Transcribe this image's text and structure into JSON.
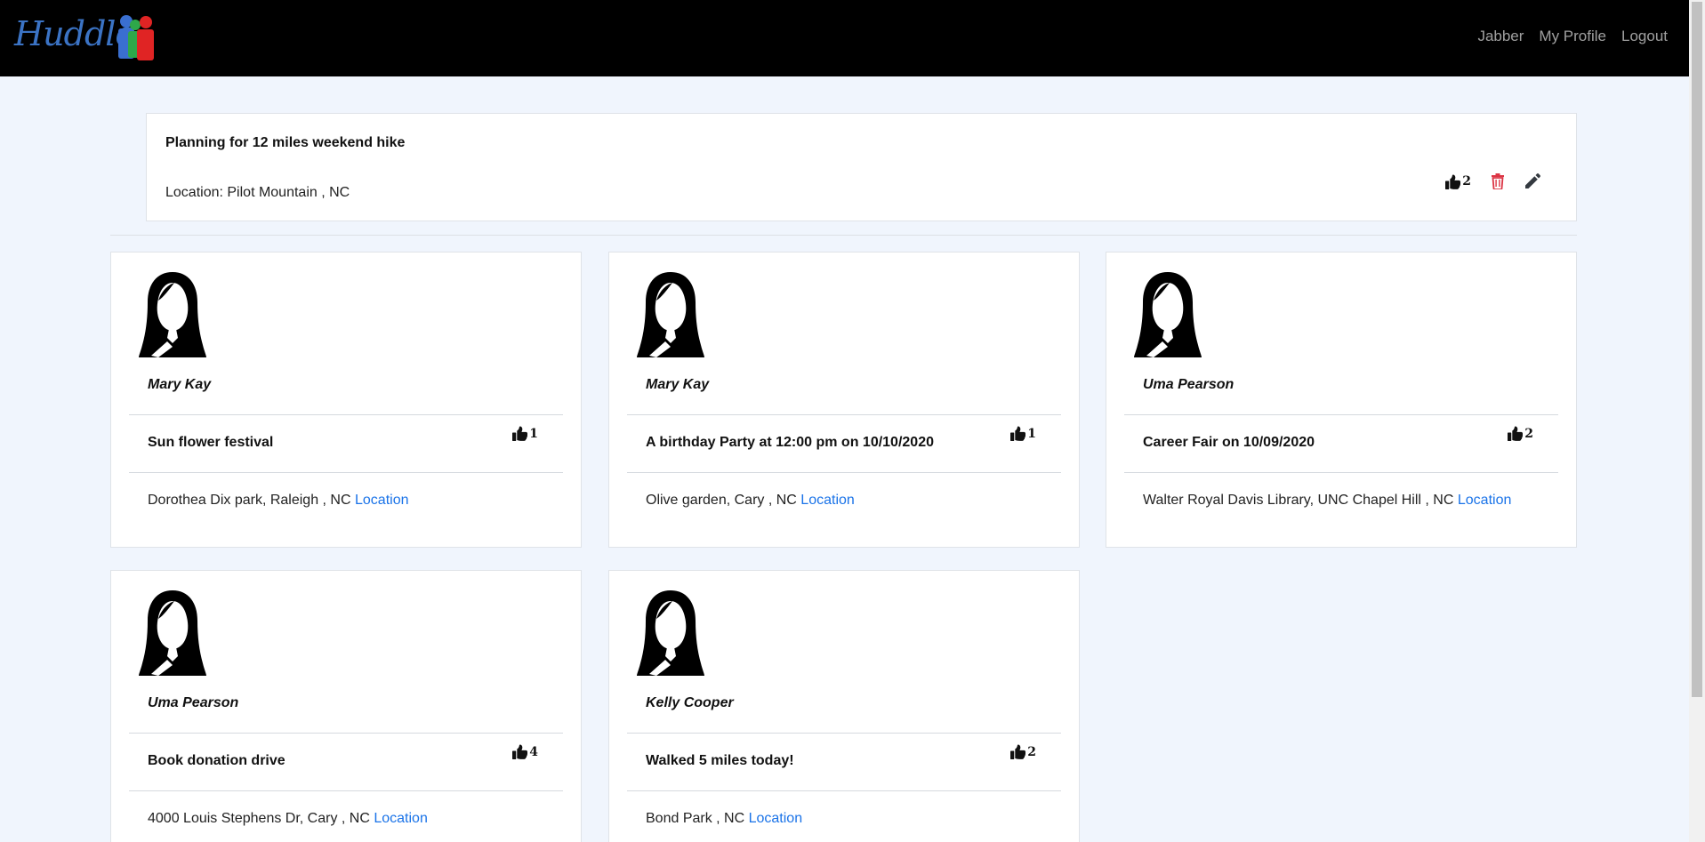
{
  "app": {
    "brand": "Huddle",
    "nav": [
      "Jabber",
      "My Profile",
      "Logout"
    ]
  },
  "colors": {
    "navbar": "#000000",
    "link": "#1a73e8",
    "delete": "#dc3545",
    "background": "#f0f5fd"
  },
  "icons": {
    "like": "thumbs-up-icon",
    "delete": "trash-icon",
    "edit": "pencil-icon",
    "avatar": "female-avatar-icon"
  },
  "main_post": {
    "title": "Planning for 12 miles weekend hike",
    "location": "Location: Pilot Mountain , NC",
    "likes": "2"
  },
  "posts": [
    {
      "author": "Mary Kay",
      "title": "Sun flower festival",
      "likes": "1",
      "location": "Dorothea Dix park, Raleigh , NC",
      "link": "Location"
    },
    {
      "author": "Mary Kay",
      "title": "A birthday Party at 12:00 pm on 10/10/2020",
      "likes": "1",
      "location": "Olive garden, Cary , NC",
      "link": "Location"
    },
    {
      "author": "Uma Pearson",
      "title": "Career Fair on 10/09/2020",
      "likes": "2",
      "location": "Walter Royal Davis Library, UNC Chapel Hill , NC",
      "link": "Location"
    },
    {
      "author": "Uma Pearson",
      "title": "Book donation drive",
      "likes": "4",
      "location": "4000 Louis Stephens Dr, Cary , NC",
      "link": "Location"
    },
    {
      "author": "Kelly Cooper",
      "title": "Walked 5 miles today!",
      "likes": "2",
      "location": "Bond Park , NC",
      "link": "Location"
    }
  ]
}
